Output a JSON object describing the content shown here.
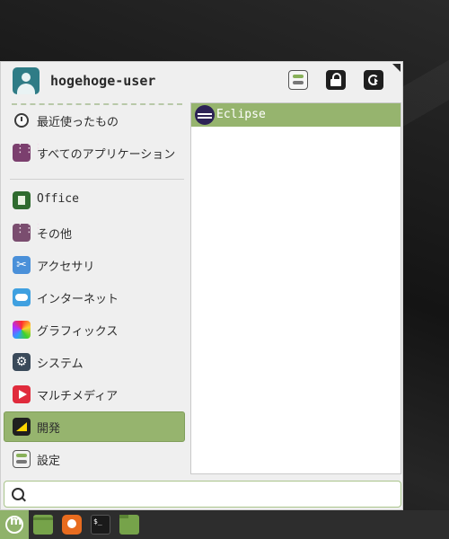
{
  "user": {
    "name": "hogehoge-user"
  },
  "header_buttons": [
    "settings",
    "lock-screen",
    "logout"
  ],
  "sidebar": {
    "items": [
      {
        "label": "最近使ったもの",
        "icon": "clock-icon"
      },
      {
        "label": "すべてのアプリケーション",
        "icon": "grid-icon"
      },
      {
        "label": "Office",
        "icon": "office-icon"
      },
      {
        "label": "その他",
        "icon": "other-icon"
      },
      {
        "label": "アクセサリ",
        "icon": "accessories-icon"
      },
      {
        "label": "インターネット",
        "icon": "internet-icon"
      },
      {
        "label": "グラフィックス",
        "icon": "graphics-icon"
      },
      {
        "label": "システム",
        "icon": "system-icon"
      },
      {
        "label": "マルチメディア",
        "icon": "multimedia-icon"
      },
      {
        "label": "開発",
        "icon": "development-icon",
        "selected": true
      },
      {
        "label": "設定",
        "icon": "preferences-icon"
      }
    ]
  },
  "apps": [
    {
      "label": "Eclipse",
      "icon": "eclipse-icon",
      "selected": true
    }
  ],
  "search": {
    "value": "",
    "placeholder": ""
  },
  "taskbar": {
    "items": [
      "menu-icon",
      "files-icon",
      "firefox-icon",
      "terminal-icon",
      "folder-icon"
    ],
    "terminal_text": "$_"
  },
  "colors": {
    "accent": "#96b46e",
    "panel": "#2d2d2d"
  }
}
